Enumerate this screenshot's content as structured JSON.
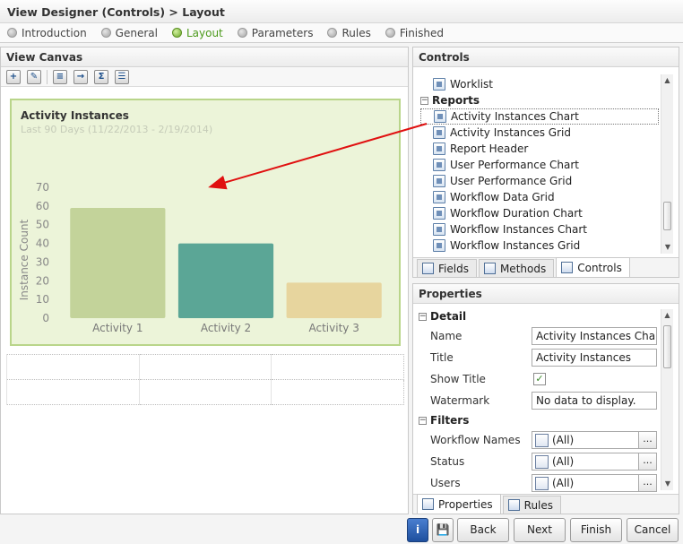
{
  "header": {
    "title": "View Designer (Controls) > Layout"
  },
  "steps": [
    {
      "label": "Introduction",
      "active": false
    },
    {
      "label": "General",
      "active": false
    },
    {
      "label": "Layout",
      "active": true
    },
    {
      "label": "Parameters",
      "active": false
    },
    {
      "label": "Rules",
      "active": false
    },
    {
      "label": "Finished",
      "active": false
    }
  ],
  "canvas": {
    "title": "View Canvas",
    "toolbar_icons": [
      "add-control-icon",
      "edit-icon",
      "insert-row-icon",
      "export-icon",
      "sum-icon",
      "properties-icon"
    ],
    "chart": {
      "title": "Activity Instances",
      "subtitle": "Last 90 Days (11/22/2013 - 2/19/2014)"
    }
  },
  "chart_data": {
    "type": "bar",
    "title": "Activity Instances",
    "subtitle": "Last 90 Days (11/22/2013 - 2/19/2014)",
    "categories": [
      "Activity 1",
      "Activity 2",
      "Activity 3"
    ],
    "values": [
      59,
      40,
      19
    ],
    "colors": [
      "#c3d39a",
      "#5ba696",
      "#e7d59e"
    ],
    "ylabel": "Instance Count",
    "xlabel": "",
    "ylim": [
      0,
      70
    ],
    "yticks": [
      "0",
      "10",
      "20",
      "30",
      "40",
      "50",
      "60",
      "70"
    ],
    "grid": false,
    "legend": "none"
  },
  "controls": {
    "title": "Controls",
    "items": [
      {
        "label": "Worklist",
        "group": false
      },
      {
        "label": "Reports",
        "group": true
      },
      {
        "label": "Activity Instances Chart",
        "group": false,
        "selected": true
      },
      {
        "label": "Activity Instances Grid",
        "group": false
      },
      {
        "label": "Report Header",
        "group": false
      },
      {
        "label": "User Performance Chart",
        "group": false
      },
      {
        "label": "User Performance Grid",
        "group": false
      },
      {
        "label": "Workflow Data Grid",
        "group": false
      },
      {
        "label": "Workflow Duration Chart",
        "group": false
      },
      {
        "label": "Workflow Instances Chart",
        "group": false
      },
      {
        "label": "Workflow Instances Grid",
        "group": false
      }
    ],
    "tabs": [
      {
        "label": "Fields",
        "active": false
      },
      {
        "label": "Methods",
        "active": false
      },
      {
        "label": "Controls",
        "active": true
      }
    ]
  },
  "properties": {
    "title": "Properties",
    "detail_label": "Detail",
    "name_label": "Name",
    "name_value": "Activity Instances Chart",
    "title_label": "Title",
    "title_value": "Activity Instances",
    "show_title_label": "Show Title",
    "show_title_checked": "✓",
    "watermark_label": "Watermark",
    "watermark_value": "No data to display.",
    "filters_label": "Filters",
    "workflow_names_label": "Workflow Names",
    "workflow_names_value": "(All)",
    "status_label": "Status",
    "status_value": "(All)",
    "users_label": "Users",
    "users_value": "(All)",
    "more": "...",
    "collapse": "−",
    "tabs": [
      {
        "label": "Properties",
        "active": true
      },
      {
        "label": "Rules",
        "active": false
      }
    ]
  },
  "footer": {
    "info_icon": "i",
    "save_icon": "💾",
    "back": "Back",
    "next": "Next",
    "finish": "Finish",
    "cancel": "Cancel"
  },
  "colors": {
    "accent_green": "#6aa92a",
    "chart_bg": "#ecf4d9",
    "arrow": "#e01010"
  }
}
